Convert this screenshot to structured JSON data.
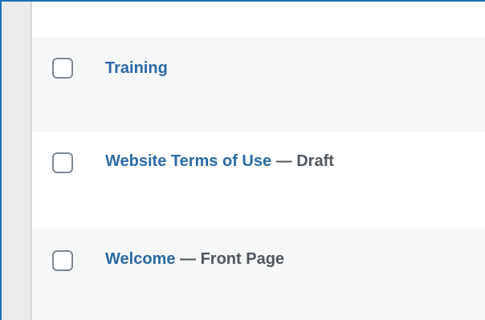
{
  "rows": [
    {
      "title": "Training",
      "separator": "",
      "state": ""
    },
    {
      "title": "Website Terms of Use",
      "separator": " — ",
      "state": "Draft"
    },
    {
      "title": "Welcome",
      "separator": " — ",
      "state": "Front Page"
    }
  ],
  "colors": {
    "link": "#2c6aa6",
    "state": "#50575e",
    "row_alt": "#f6f7f7",
    "frame_border": "#1d6fb8"
  }
}
